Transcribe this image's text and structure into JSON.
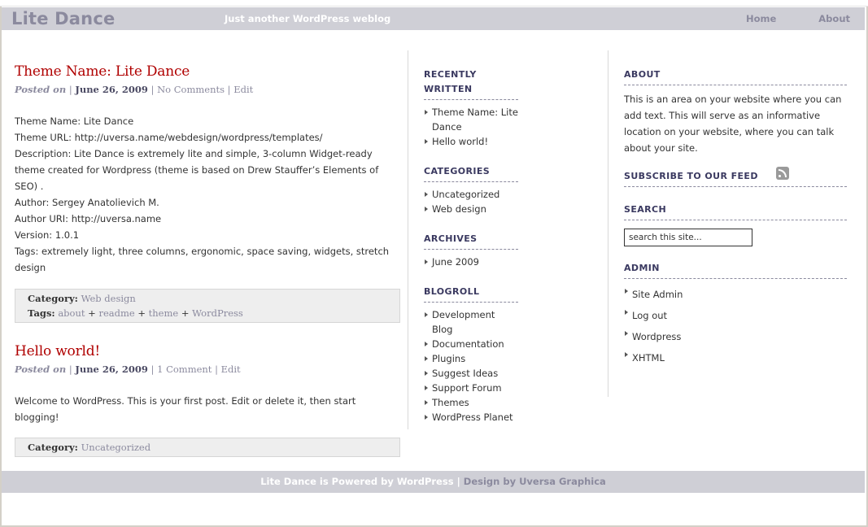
{
  "header": {
    "site_title": "Lite Dance",
    "tagline": "Just another WordPress weblog",
    "nav": [
      "Home",
      "About"
    ]
  },
  "posts": [
    {
      "title": "Theme Name: Lite Dance",
      "posted_on": "Posted on",
      "date": "June 26, 2009",
      "comments": "No Comments",
      "edit": "Edit",
      "body": [
        "Theme Name: Lite Dance",
        "Theme URL: http://uversa.name/webdesign/wordpress/templates/",
        "Description: Lite Dance is extremely lite and simple, 3-column Widget-ready theme created for Wordpress (theme is based on Drew Stauffer’s Elements of SEO) .",
        "Author: Sergey Anatolievich M.",
        "Author URI: http://uversa.name",
        "Version: 1.0.1",
        "Tags: extremely light, three columns, ergonomic, space saving, widgets, stretch design"
      ],
      "category_label": "Category:",
      "category": "Web design",
      "tags_label": "Tags:",
      "tags": [
        "about",
        "readme",
        "theme",
        "WordPress"
      ],
      "tag_sep": "+"
    },
    {
      "title": "Hello world!",
      "posted_on": "Posted on",
      "date": "June 26, 2009",
      "comments": "1 Comment",
      "edit": "Edit",
      "body": [
        "Welcome to WordPress. This is your first post. Edit or delete it, then start blogging!"
      ],
      "category_label": "Category:",
      "category": "Uncategorized"
    }
  ],
  "sidebar_mid": {
    "recent_title_line1": "RECENTLY",
    "recent_title_line2": "WRITTEN",
    "recent": [
      "Theme Name: Lite Dance",
      "Hello world!"
    ],
    "categories_title": "CATEGORIES",
    "categories": [
      "Uncategorized",
      "Web design"
    ],
    "archives_title": "ARCHIVES",
    "archives": [
      "June 2009"
    ],
    "blogroll_title": "BLOGROLL",
    "blogroll": [
      "Development Blog",
      "Documentation",
      "Plugins",
      "Suggest Ideas",
      "Support Forum",
      "Themes",
      "WordPress Planet"
    ]
  },
  "sidebar_right": {
    "about_title": "ABOUT",
    "about_text": "This is an area on your website where you can add text. This will serve as an informative location on your website, where you can talk about your site.",
    "subscribe_title": "SUBSCRIBE TO OUR FEED",
    "feed_icon": "rss-feed-icon",
    "search_title": "SEARCH",
    "search_value": "search this site...",
    "admin_title": "ADMIN",
    "admin": [
      "Site Admin",
      "Log out",
      "Wordpress",
      "XHTML"
    ]
  },
  "footer": {
    "powered": "Lite Dance is Powered by WordPress",
    "pipe": "|",
    "design": "Design by Uversa Graphica"
  },
  "colors": {
    "header_bg": "#cfcfd6",
    "title_color": "#8b8a9e",
    "post_title_red": "#b00000",
    "widget_title": "#3a3960"
  }
}
